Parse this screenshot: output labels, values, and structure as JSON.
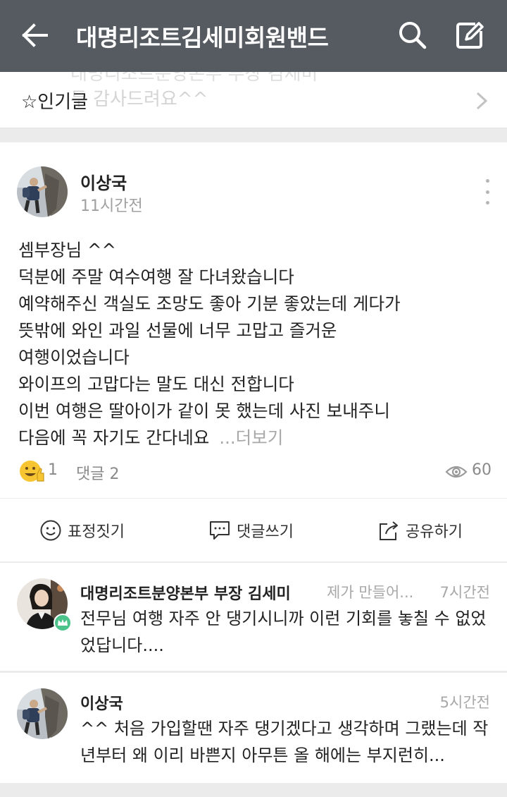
{
  "appbar": {
    "title": "대명리조트김세미회원밴드",
    "back_icon": "arrow-left-icon",
    "search_icon": "search-icon",
    "write_icon": "edit-icon"
  },
  "popular": {
    "label": "☆인기글",
    "ghost_text": "두 감사드려요^^",
    "ghost_top": "대명리조트분양본부 부장 김세미"
  },
  "post": {
    "author": "이상국",
    "time": "11시간전",
    "lines": [
      "셈부장님 ^^",
      "덕분에 주말 여수여행  잘 다녀왔습니다",
      "예약해주신 객실도  조망도 좋아 기분 좋았는데 게다가",
      "뜻밖에 와인 과일 선물에 너무 고맙고 즐거운",
      "여행이었습니다",
      "와이프의 고맙다는 말도 대신 전합니다",
      "이번 여행은 딸아이가 같이 못 했는데 사진 보내주니",
      "다음에 꼭 자기도 간다네요"
    ],
    "see_more": "...더보기",
    "likes": "1",
    "comments": "댓글 2",
    "views": "60"
  },
  "actions": {
    "emote": "표정짓기",
    "comment": "댓글쓰기",
    "share": "공유하기"
  },
  "comments": [
    {
      "author": "대명리조트분양본부 부장 김세미",
      "meta": "제가 만들어...",
      "time": "7시간전",
      "text": "전무님 여행 자주 안 댕기시니까 이런 기회를 놓칠 수 없었었답니다...."
    },
    {
      "author": "이상국",
      "time": "5시간전",
      "text": "^^ 처음 가입할땐 자주 댕기겠다고 생각하며 그랬는데 작년부터 왜 이리 바쁜지 아무튼 올 해에는 부지런히..."
    }
  ],
  "colors": {
    "appbar": "#555b60",
    "muted": "#a0a0a0",
    "badge": "#4cc38a"
  }
}
